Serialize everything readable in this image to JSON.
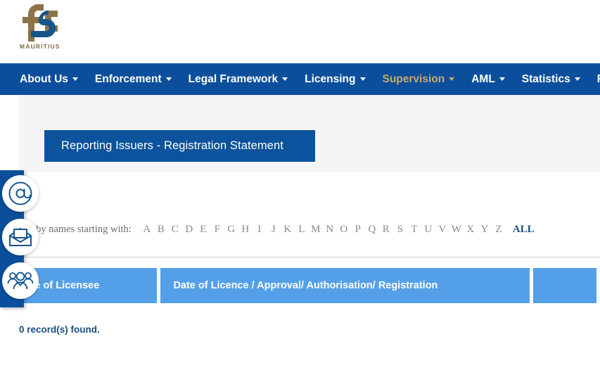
{
  "site": {
    "logo_icon": "fsc-mauritius-logo",
    "logo_wordmark": "MAURITIUS"
  },
  "nav": {
    "items": [
      {
        "label": "About Us",
        "has_caret": true,
        "active": false,
        "icon": "chevron-down-icon"
      },
      {
        "label": "Enforcement",
        "has_caret": true,
        "active": false,
        "icon": "chevron-down-icon"
      },
      {
        "label": "Legal Framework",
        "has_caret": true,
        "active": false,
        "icon": "chevron-down-icon"
      },
      {
        "label": "Licensing",
        "has_caret": true,
        "active": false,
        "icon": "chevron-down-icon"
      },
      {
        "label": "Supervision",
        "has_caret": true,
        "active": true,
        "icon": "chevron-down-icon"
      },
      {
        "label": "AML",
        "has_caret": true,
        "active": false,
        "icon": "chevron-down-icon"
      },
      {
        "label": "Statistics",
        "has_caret": true,
        "active": false,
        "icon": "chevron-down-icon"
      },
      {
        "label": "RCE",
        "has_caret": true,
        "active": false,
        "icon": "chevron-down-icon"
      }
    ],
    "active_color": "#c9a96a",
    "bar_color": "#0b4f9c"
  },
  "page": {
    "title": "Reporting Issuers - Registration Statement",
    "title_banner_color": "#0b539c"
  },
  "search": {
    "label": "Search by names starting with:",
    "letters": [
      "A",
      "B",
      "C",
      "D",
      "E",
      "F",
      "G",
      "H",
      "I",
      "J",
      "K",
      "L",
      "M",
      "N",
      "O",
      "P",
      "Q",
      "R",
      "S",
      "T",
      "U",
      "V",
      "W",
      "X",
      "Y",
      "Z"
    ],
    "all_label": "ALL",
    "all_color": "#1a4f86"
  },
  "table": {
    "header_color": "#54a0e8",
    "columns": [
      {
        "label": "Name of Licensee"
      },
      {
        "label": "Date of Licence / Approval/ Authorisation/ Registration"
      },
      {
        "label": ""
      }
    ],
    "rows": [],
    "record_count_text": "0 record(s) found."
  },
  "side_rail": {
    "background": "#0b4f9c",
    "buttons": [
      {
        "icon": "at-sign-icon",
        "name": "contact-email-button"
      },
      {
        "icon": "open-envelope-icon",
        "name": "newsletter-button"
      },
      {
        "icon": "people-group-icon",
        "name": "community-button"
      }
    ]
  }
}
